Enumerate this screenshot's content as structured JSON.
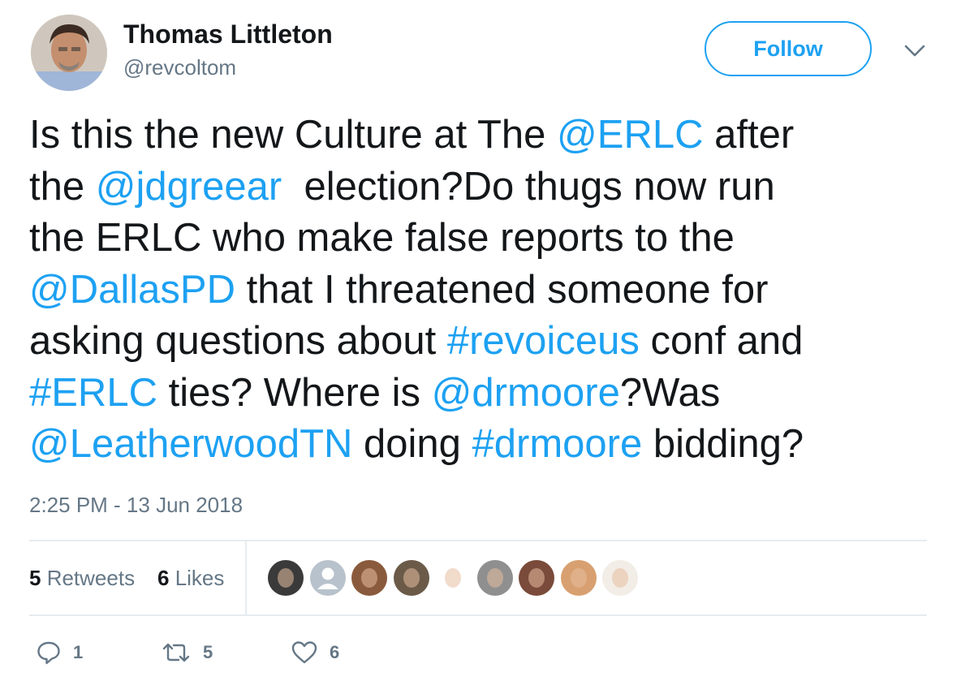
{
  "author": {
    "name": "Thomas Littleton",
    "handle": "@revcoltom"
  },
  "follow_label": "Follow",
  "tweet_lines": [
    [
      {
        "t": "Is this the new Culture at The ",
        "link": false
      },
      {
        "t": "@ERLC",
        "link": true
      },
      {
        "t": " after",
        "link": false
      }
    ],
    [
      {
        "t": "the ",
        "link": false
      },
      {
        "t": "@jdgreear",
        "link": true
      },
      {
        "t": "  election?Do thugs now run",
        "link": false
      }
    ],
    [
      {
        "t": "the ERLC who make false reports to the",
        "link": false
      }
    ],
    [
      {
        "t": "@DallasPD",
        "link": true
      },
      {
        "t": " that I threatened someone for",
        "link": false
      }
    ],
    [
      {
        "t": "asking questions about ",
        "link": false
      },
      {
        "t": "#revoiceus",
        "link": true
      },
      {
        "t": " conf and",
        "link": false
      }
    ],
    [
      {
        "t": "#ERLC",
        "link": true
      },
      {
        "t": " ties? Where is ",
        "link": false
      },
      {
        "t": "@drmoore",
        "link": true
      },
      {
        "t": "?Was",
        "link": false
      }
    ],
    [
      {
        "t": "@LeatherwoodTN",
        "link": true
      },
      {
        "t": " doing ",
        "link": false
      },
      {
        "t": "#drmoore",
        "link": true
      },
      {
        "t": " bidding?",
        "link": false
      }
    ]
  ],
  "timestamp": "2:25 PM - 13 Jun 2018",
  "stats": {
    "retweets_count": "5",
    "retweets_label": " Retweets",
    "likes_count": "6",
    "likes_label": " Likes"
  },
  "likers": [
    {
      "name": "liker-1",
      "color": "#3a3a3a"
    },
    {
      "name": "liker-2",
      "color": "#b8c2cc"
    },
    {
      "name": "liker-3",
      "color": "#8a5a3c"
    },
    {
      "name": "liker-4",
      "color": "#6b5a48"
    },
    {
      "name": "liker-5",
      "color": "#ffffff"
    },
    {
      "name": "liker-6",
      "color": "#8f8f8f"
    },
    {
      "name": "liker-7",
      "color": "#7a4a3a"
    },
    {
      "name": "liker-8",
      "color": "#d8a070"
    },
    {
      "name": "liker-9",
      "color": "#f2ede6"
    }
  ],
  "actions": {
    "reply_count": "1",
    "retweet_count": "5",
    "like_count": "6"
  },
  "colors": {
    "link": "#1da1f2",
    "text": "#14171a",
    "muted": "#657786",
    "divider": "#e6ecf0"
  }
}
